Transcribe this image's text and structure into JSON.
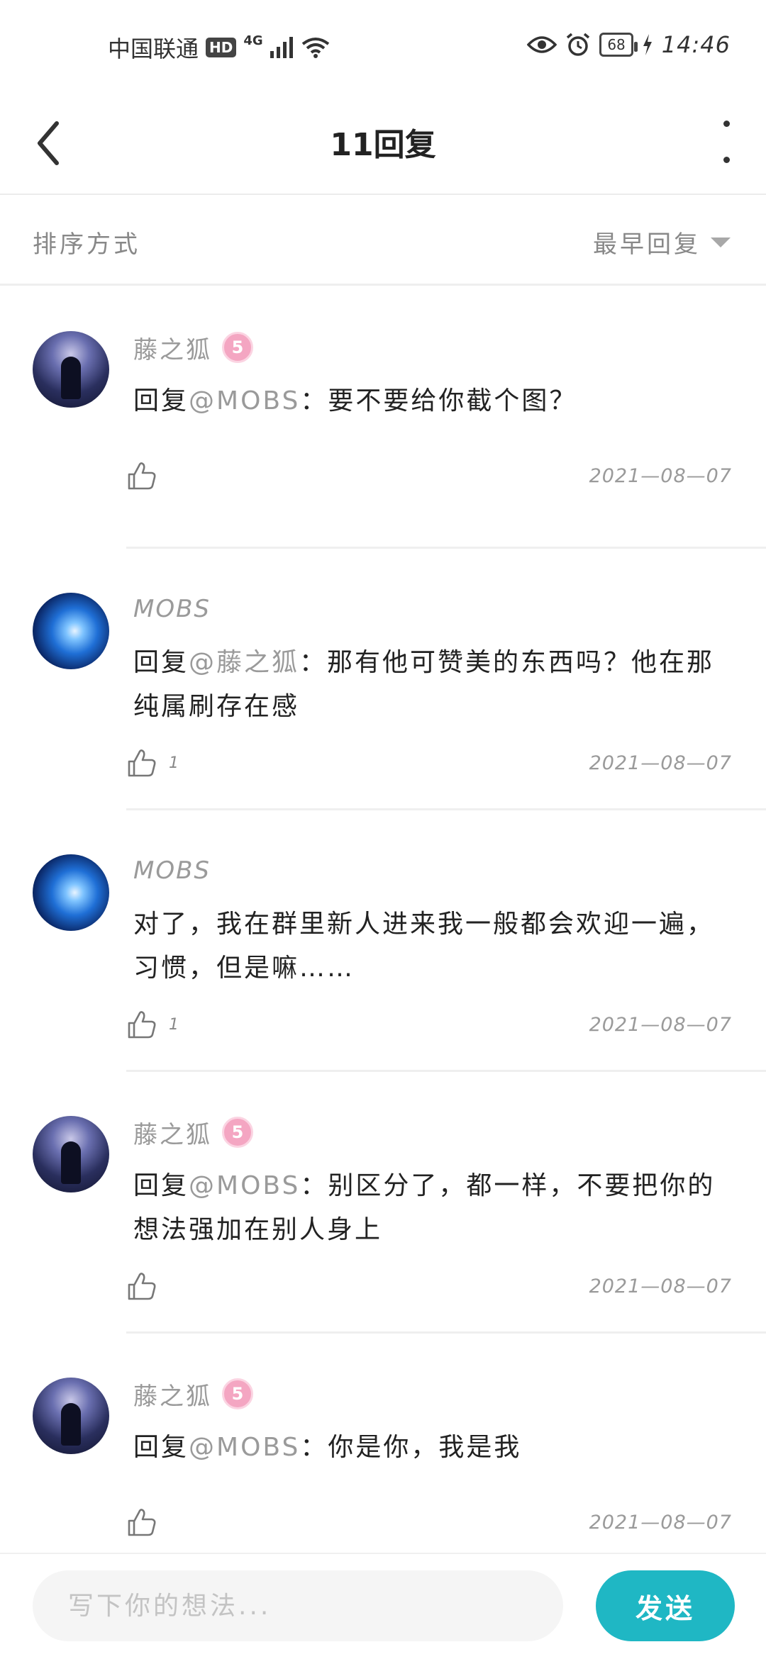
{
  "status_bar": {
    "carrier": "中国联通",
    "hd": "HD",
    "network": "4G",
    "battery": "68",
    "time": "14:46"
  },
  "header": {
    "title": "11回复"
  },
  "sort": {
    "label": "排序方式",
    "selected": "最早回复"
  },
  "comments": [
    {
      "user": "藤之狐",
      "level": "5",
      "prefix": "回复",
      "mention": "@MOBS",
      "text": "：要不要给你截个图？",
      "likes": "",
      "date": "2021—08—07"
    },
    {
      "user": "MOBS",
      "level": "",
      "prefix": "回复",
      "mention": "@藤之狐",
      "text": "：那有他可赞美的东西吗？他在那纯属刷存在感",
      "likes": "1",
      "date": "2021—08—07"
    },
    {
      "user": "MOBS",
      "level": "",
      "prefix": "",
      "mention": "",
      "text": "对了，我在群里新人进来我一般都会欢迎一遍，习惯，但是嘛……",
      "likes": "1",
      "date": "2021—08—07"
    },
    {
      "user": "藤之狐",
      "level": "5",
      "prefix": "回复",
      "mention": "@MOBS",
      "text": "：别区分了，都一样，不要把你的想法强加在别人身上",
      "likes": "",
      "date": "2021—08—07"
    },
    {
      "user": "藤之狐",
      "level": "5",
      "prefix": "回复",
      "mention": "@MOBS",
      "text": "：你是你，我是我",
      "likes": "",
      "date": "2021—08—07"
    }
  ],
  "bottom": {
    "placeholder": "写下你的想法...",
    "send_label": "发送"
  },
  "colors": {
    "accent": "#1fb7c4",
    "badge": "#f4a6c2",
    "muted_text": "#9a9a9a"
  }
}
